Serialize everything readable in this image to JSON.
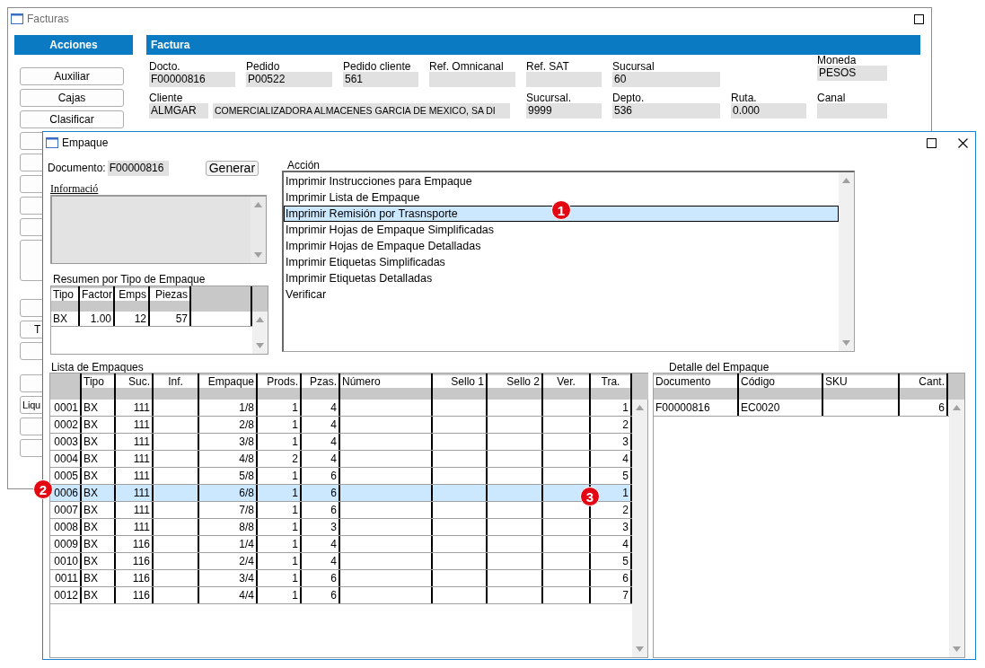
{
  "facturas": {
    "title": "Facturas",
    "acciones": {
      "title": "Acciones",
      "buttons": [
        {
          "kind": "normal",
          "label": "Auxiliar"
        },
        {
          "kind": "normal",
          "label": "Cajas"
        },
        {
          "kind": "normal",
          "label": "Clasificar"
        },
        {
          "kind": "normal"
        },
        {
          "kind": "normal"
        },
        {
          "kind": "normal"
        },
        {
          "kind": "normal"
        },
        {
          "kind": "normal"
        },
        {
          "kind": "tall"
        },
        {
          "kind": "normal"
        },
        {
          "kind": "normal",
          "label": "T"
        },
        {
          "kind": "normal"
        },
        {
          "kind": "normal"
        },
        {
          "kind": "normal",
          "label": "Liqu"
        },
        {
          "kind": "normal"
        },
        {
          "kind": "normal"
        }
      ]
    },
    "factura": {
      "title": "Factura",
      "fields": [
        {
          "label": "Docto.",
          "value": "F00000816"
        },
        {
          "label": "Pedido",
          "value": "P00522"
        },
        {
          "label": "Pedido cliente",
          "value": "561"
        },
        {
          "label": "Ref. Omnicanal"
        },
        {
          "label": "Ref. SAT"
        },
        {
          "label": "Sucursal",
          "value": "60"
        },
        {
          "label": "Moneda",
          "value": "PESOS"
        }
      ],
      "cliente": {
        "label": "Cliente",
        "code": "ALMGAR",
        "name": "COMERCIALIZADORA ALMACENES GARCIA DE MEXICO, SA DI"
      },
      "fields2": [
        {
          "label": "Sucursal.",
          "value": "9999"
        },
        {
          "label": "Depto.",
          "value": "536"
        },
        {
          "label": "Ruta.",
          "value": "0.000"
        },
        {
          "label": "Canal"
        }
      ]
    }
  },
  "empaque": {
    "title": "Empaque",
    "documento": {
      "label": "Documento:",
      "value": "F00000816"
    },
    "generar": "Generar",
    "informacion": {
      "label": "Informació"
    },
    "resumen": {
      "title": "Resumen por Tipo de Empaque",
      "columns": [
        "Tipo",
        "Factor",
        "Emps",
        "Piezas"
      ],
      "rows": [
        {
          "tipo": "BX",
          "factor": "1.00",
          "emps": "12",
          "piezas": "57"
        }
      ]
    },
    "accion": {
      "label": "Acción",
      "items": [
        {
          "label": "Imprimir Instrucciones para Empaque",
          "selected": false
        },
        {
          "label": "Imprimir Lista de Empaque",
          "selected": false
        },
        {
          "label": "Imprimir Remisión por Trasnsporte",
          "selected": true
        },
        {
          "label": "Imprimir Hojas de Empaque Simplificadas",
          "selected": false
        },
        {
          "label": "Imprimir Hojas de Empaque Detalladas",
          "selected": false
        },
        {
          "label": "Imprimir Etiquetas Simplificadas",
          "selected": false
        },
        {
          "label": "Imprimir Etiquetas Detalladas",
          "selected": false
        },
        {
          "label": "Verificar",
          "selected": false
        }
      ]
    },
    "lista": {
      "title": "Lista de Empaques",
      "columns": [
        "Tipo",
        "Suc.",
        "Inf.",
        "Empaque",
        "Prods.",
        "Pzas.",
        "Número",
        "Sello 1",
        "Sello 2",
        "Ver.",
        "Tra."
      ],
      "rows": [
        {
          "n": "0001",
          "tipo": "BX",
          "suc": "111",
          "empaque": "1/8",
          "prods": "1",
          "pzas": "4",
          "tra": "1",
          "selected": false
        },
        {
          "n": "0002",
          "tipo": "BX",
          "suc": "111",
          "empaque": "2/8",
          "prods": "1",
          "pzas": "4",
          "tra": "2",
          "selected": false
        },
        {
          "n": "0003",
          "tipo": "BX",
          "suc": "111",
          "empaque": "3/8",
          "prods": "1",
          "pzas": "4",
          "tra": "3",
          "selected": false
        },
        {
          "n": "0004",
          "tipo": "BX",
          "suc": "111",
          "empaque": "4/8",
          "prods": "2",
          "pzas": "4",
          "tra": "4",
          "selected": false
        },
        {
          "n": "0005",
          "tipo": "BX",
          "suc": "111",
          "empaque": "5/8",
          "prods": "1",
          "pzas": "6",
          "tra": "5",
          "selected": false
        },
        {
          "n": "0006",
          "tipo": "BX",
          "suc": "111",
          "empaque": "6/8",
          "prods": "1",
          "pzas": "6",
          "tra": "1",
          "selected": true
        },
        {
          "n": "0007",
          "tipo": "BX",
          "suc": "111",
          "empaque": "7/8",
          "prods": "1",
          "pzas": "6",
          "tra": "2",
          "selected": false
        },
        {
          "n": "0008",
          "tipo": "BX",
          "suc": "111",
          "empaque": "8/8",
          "prods": "1",
          "pzas": "3",
          "tra": "3",
          "selected": false
        },
        {
          "n": "0009",
          "tipo": "BX",
          "suc": "116",
          "empaque": "1/4",
          "prods": "1",
          "pzas": "4",
          "tra": "4",
          "selected": false
        },
        {
          "n": "0010",
          "tipo": "BX",
          "suc": "116",
          "empaque": "2/4",
          "prods": "1",
          "pzas": "4",
          "tra": "5",
          "selected": false
        },
        {
          "n": "0011",
          "tipo": "BX",
          "suc": "116",
          "empaque": "3/4",
          "prods": "1",
          "pzas": "6",
          "tra": "6",
          "selected": false
        },
        {
          "n": "0012",
          "tipo": "BX",
          "suc": "116",
          "empaque": "4/4",
          "prods": "1",
          "pzas": "6",
          "tra": "7",
          "selected": false
        }
      ]
    },
    "detalle": {
      "title": "Detalle del Empaque",
      "columns": [
        "Documento",
        "Código",
        "SKU",
        "Cant."
      ],
      "rows": [
        {
          "documento": "F00000816",
          "codigo": "EC0020",
          "cant": "6"
        }
      ]
    }
  },
  "callouts": [
    {
      "label": "1"
    },
    {
      "label": "2"
    },
    {
      "label": "3"
    }
  ]
}
